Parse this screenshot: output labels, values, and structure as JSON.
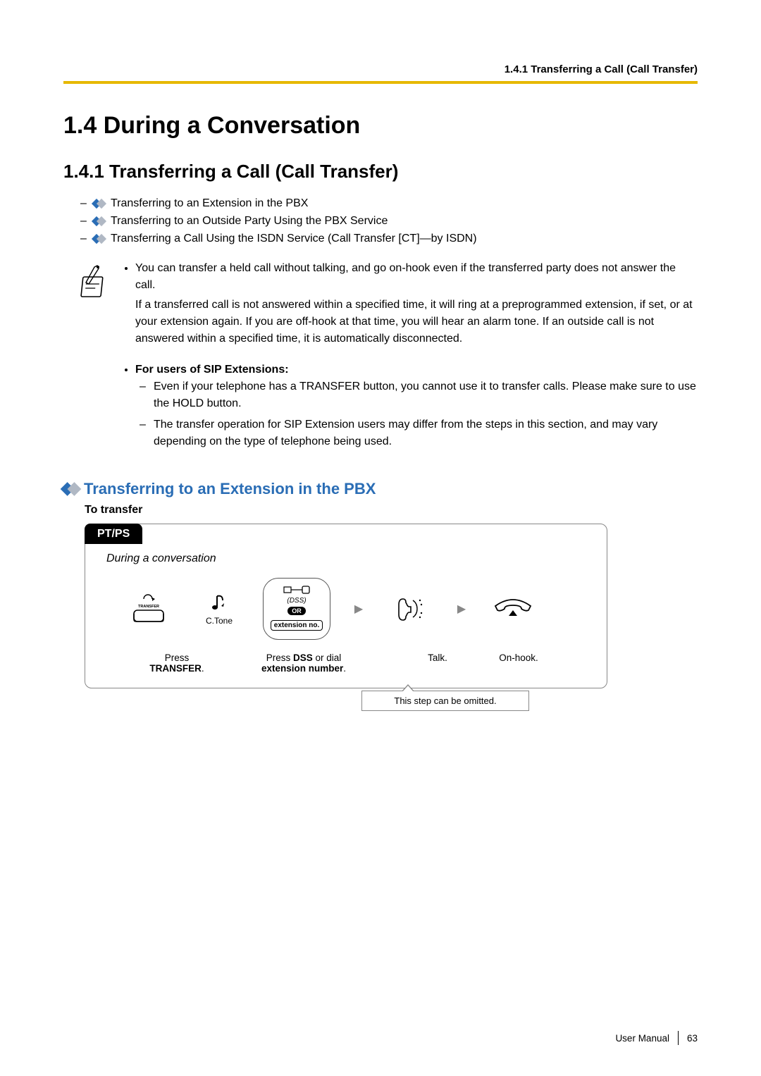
{
  "header": {
    "breadcrumb": "1.4.1 Transferring a Call (Call Transfer)"
  },
  "h1": "1.4  During a Conversation",
  "h2": "1.4.1  Transferring a Call (Call Transfer)",
  "links": [
    "Transferring to an Extension in the PBX",
    "Transferring to an Outside Party Using the PBX Service",
    "Transferring a Call Using the ISDN Service (Call Transfer [CT]—by ISDN)"
  ],
  "note": {
    "bullet1": "You can transfer a held call without talking, and go on-hook even if the transferred party does not answer the call.",
    "para1": "If a transferred call is not answered within a specified time, it will ring at a preprogrammed extension, if set, or at your extension again. If you are off-hook at that time, you will hear an alarm tone. If an outside call is not answered within a specified time, it is automatically disconnected."
  },
  "sip": {
    "title": "For users of SIP Extensions:",
    "sub1": "Even if your telephone has a TRANSFER button, you cannot use it to transfer calls. Please make sure to use the HOLD button.",
    "sub2": "The transfer operation for SIP Extension users may differ from the steps in this section, and may vary depending on the type of telephone being used."
  },
  "h3": "Transferring to an Extension in the PBX",
  "h4": "To transfer",
  "diagram": {
    "tab": "PT/PS",
    "context": "During a conversation",
    "transfer_label": "TRANSFER",
    "ctone": "C.Tone",
    "dss_label": "(DSS)",
    "or_label": "OR",
    "extno_label": "extension no.",
    "cap_transfer_line1": "Press",
    "cap_transfer_line2": "TRANSFER",
    "cap_dss_line1": "Press ",
    "cap_dss_bold": "DSS",
    "cap_dss_line2": " or dial",
    "cap_dss_line3": "extension number",
    "cap_talk": "Talk.",
    "cap_onhook": "On-hook.",
    "tooltip": "This step can be omitted."
  },
  "footer": {
    "label": "User Manual",
    "page": "63"
  }
}
